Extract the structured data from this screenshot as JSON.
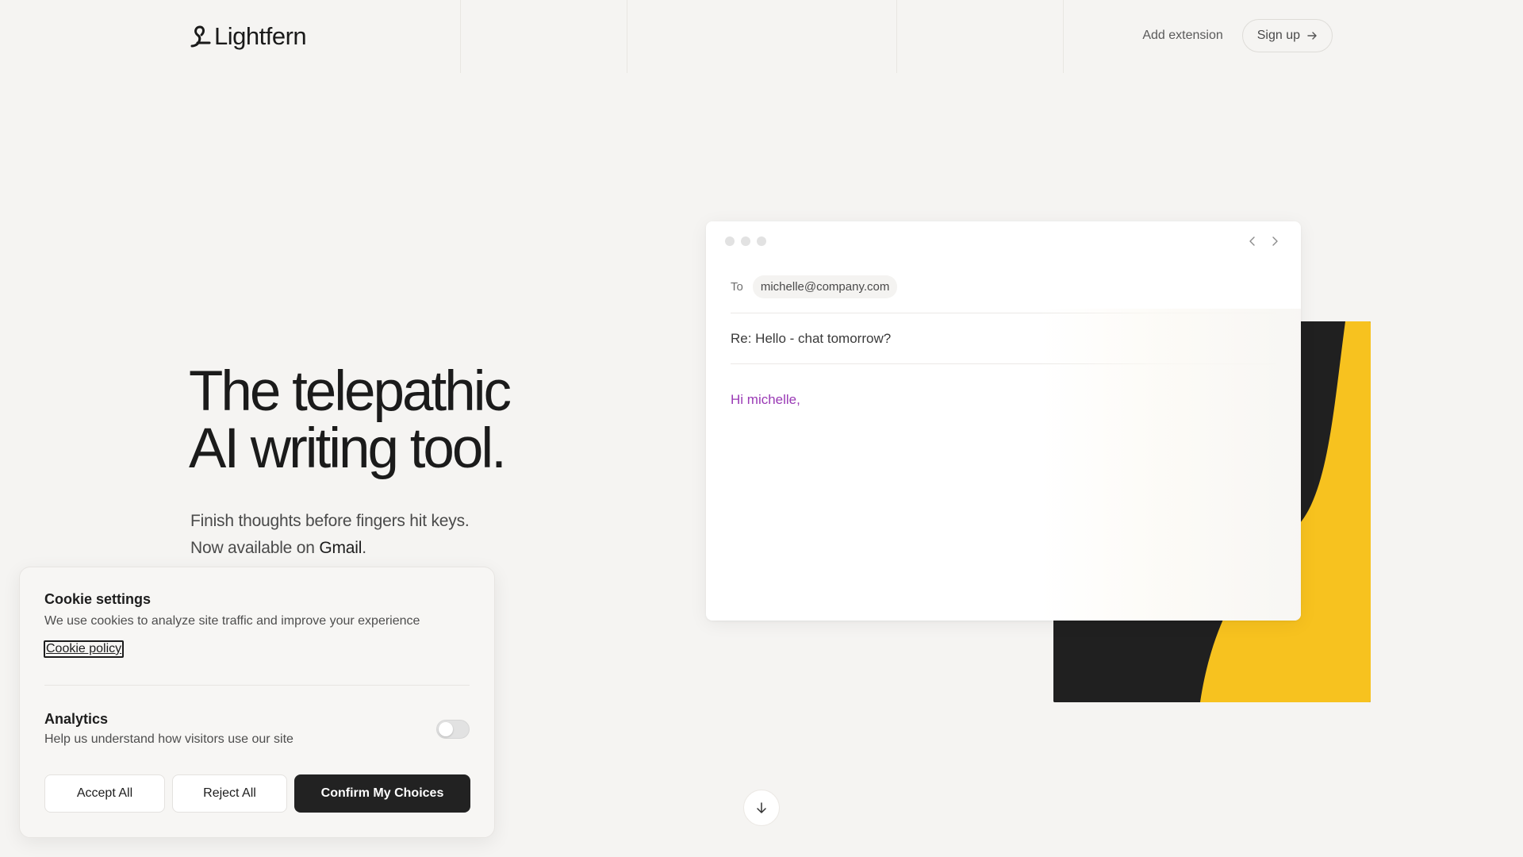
{
  "header": {
    "brand": "Lightfern",
    "add_extension": "Add extension",
    "sign_up": "Sign up"
  },
  "hero": {
    "title_line1": "The telepathic",
    "title_line2": "AI writing tool.",
    "sub_line1": "Finish thoughts before fingers hit keys.",
    "sub_line2_prefix": "Now available on ",
    "sub_line2_brand": "Gmail",
    "sub_line2_suffix": "."
  },
  "email": {
    "to_label": "To",
    "to_address": "michelle@company.com",
    "subject": "Re: Hello - chat tomorrow?",
    "greeting": "Hi michelle,"
  },
  "cookie": {
    "title": "Cookie settings",
    "description": "We use cookies to analyze site traffic and improve your experience",
    "policy_link": "Cookie policy",
    "analytics_title": "Analytics",
    "analytics_description": "Help us understand how visitors use our site",
    "analytics_enabled": false,
    "accept_all": "Accept All",
    "reject_all": "Reject All",
    "confirm": "Confirm My Choices"
  },
  "colors": {
    "background": "#f5f4f2",
    "accent_yellow": "#f7c21f",
    "art_dark": "#202020",
    "greeting_purple": "#9a3ab5",
    "button_dark": "#222222"
  },
  "icons": {
    "logo": "lightfern-logo-icon",
    "sign_up_arrow": "arrow-right-icon",
    "scroll": "arrow-down-icon",
    "card_prev": "chevron-left-icon",
    "card_next": "chevron-right-icon"
  }
}
